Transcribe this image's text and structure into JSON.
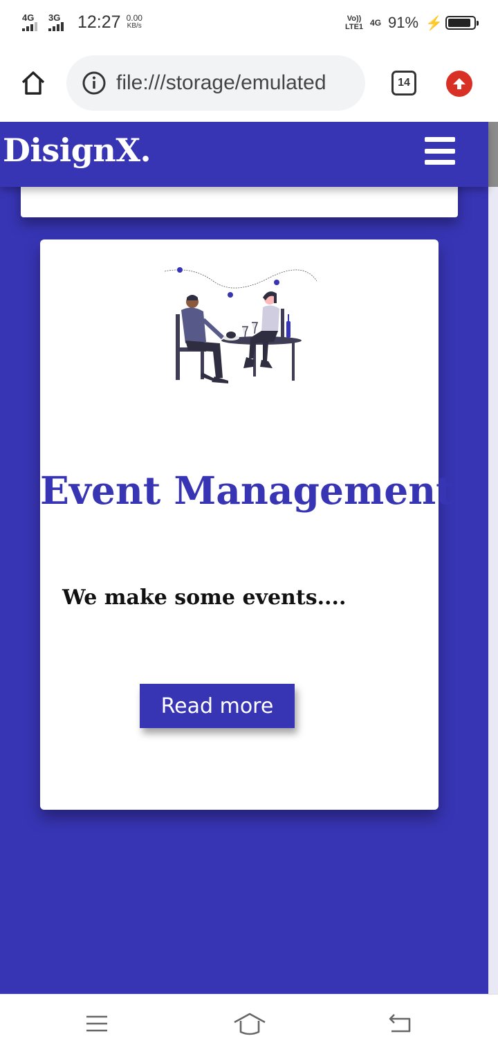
{
  "status_bar": {
    "signal1_label": "4G",
    "signal2_label": "3G",
    "time": "12:27",
    "speed_value": "0.00",
    "speed_unit": "KB/s",
    "volte_top": "Vo))",
    "volte_bottom": "LTE1",
    "net_label": "4G",
    "battery_percent": "91%",
    "battery_level": 0.91
  },
  "browser": {
    "url": "file:///storage/emulated",
    "tab_count": "14",
    "icons": {
      "home": "home-icon",
      "info": "info-icon",
      "tabs": "tab-switcher-icon",
      "update": "update-arrow-icon"
    },
    "update_color": "#d93025"
  },
  "site": {
    "logo": "DisignX.",
    "brand_color": "#3835b5",
    "menu_icon": "hamburger-menu-icon",
    "card": {
      "illustration_icon": "dinner-date-illustration",
      "title": "Event Management",
      "description": "We make some events....",
      "button_label": "Read more"
    }
  },
  "nav_bar": {
    "icons": [
      "menu-icon",
      "home-icon",
      "back-icon"
    ]
  }
}
